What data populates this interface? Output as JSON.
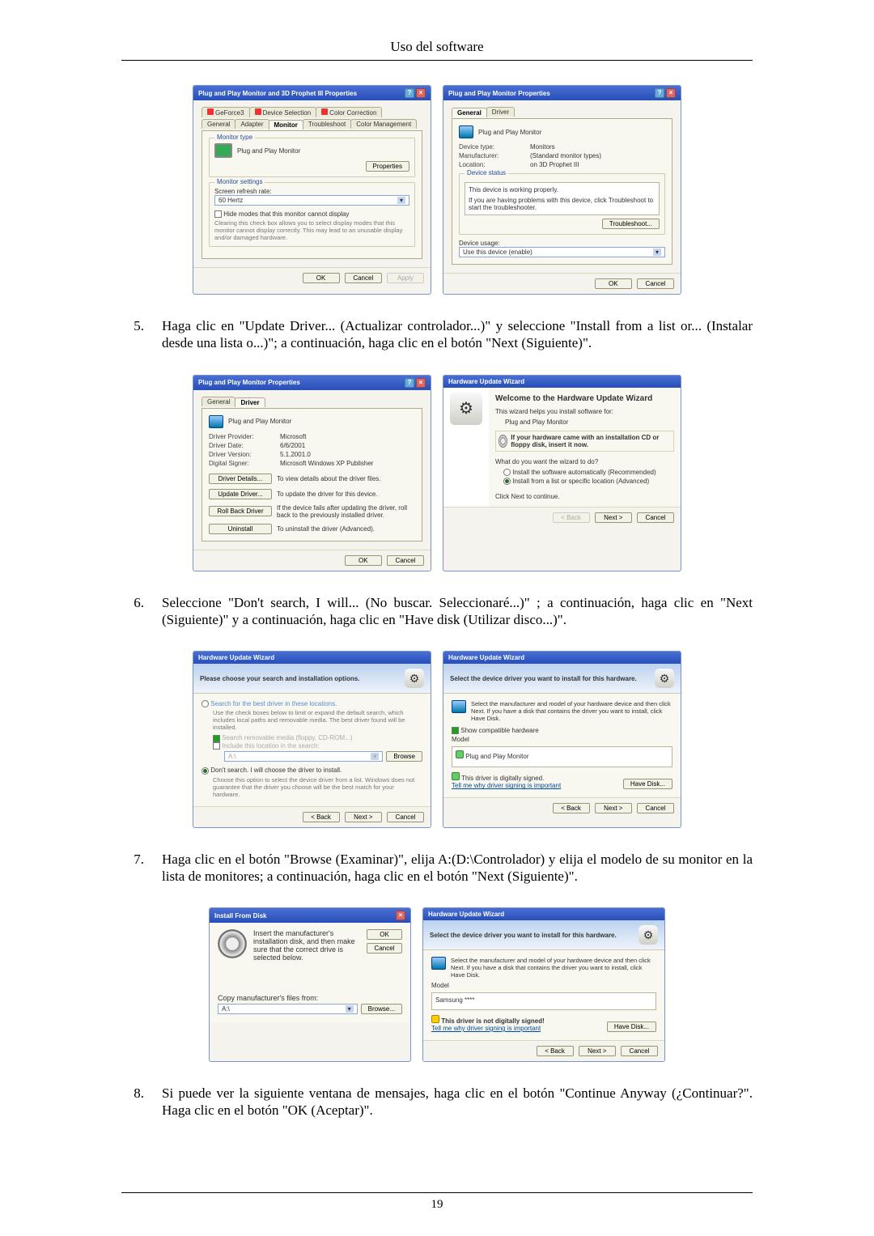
{
  "page": {
    "header": "Uso del software",
    "number": "19"
  },
  "steps": {
    "s5": {
      "num": "5.",
      "text": "Haga clic en \"Update Driver... (Actualizar controlador...)\" y seleccione \"Install from a list or... (Instalar desde una lista o...)\"; a continuación, haga clic en el botón \"Next (Siguiente)\"."
    },
    "s6": {
      "num": "6.",
      "text": "Seleccione \"Don't search, I will... (No buscar. Seleccionaré...)\" ; a continuación, haga clic en \"Next (Siguiente)\" y a continuación, haga clic en \"Have disk (Utilizar disco...)\"."
    },
    "s7": {
      "num": "7.",
      "text": "Haga clic en el botón \"Browse (Examinar)\", elija A:(D:\\Controlador) y elija el modelo de su monitor en la lista de monitores; a continuación, haga clic en el botón \"Next (Siguiente)\"."
    },
    "s8": {
      "num": "8.",
      "text": "Si puede ver la siguiente ventana de mensajes, haga clic en el botón \"Continue Anyway (¿Continuar?\". Haga clic en el botón \"OK (Aceptar)\"."
    }
  },
  "dlg1": {
    "title": "Plug and Play Monitor and 3D Prophet III Properties",
    "tabs_row1": [
      "GeForce3",
      "Device Selection",
      "Color Correction"
    ],
    "tabs_row2": [
      "General",
      "Adapter",
      "Monitor",
      "Troubleshoot",
      "Color Management"
    ],
    "monitor_type_label": "Monitor type",
    "monitor_name": "Plug and Play Monitor",
    "properties_btn": "Properties",
    "monitor_settings_label": "Monitor settings",
    "refresh_label": "Screen refresh rate:",
    "refresh_value": "60 Hertz",
    "hide_modes_label": "Hide modes that this monitor cannot display",
    "hide_modes_hint": "Clearing this check box allows you to select display modes that this monitor cannot display correctly. This may lead to an unusable display and/or damaged hardware.",
    "ok": "OK",
    "cancel": "Cancel",
    "apply": "Apply"
  },
  "dlg2": {
    "title": "Plug and Play Monitor Properties",
    "tabs": [
      "General",
      "Driver"
    ],
    "device": "Plug and Play Monitor",
    "type_label": "Device type:",
    "type_value": "Monitors",
    "manu_label": "Manufacturer:",
    "manu_value": "(Standard monitor types)",
    "loc_label": "Location:",
    "loc_value": "on 3D Prophet III",
    "status_label": "Device status",
    "status_text": "This device is working properly.",
    "status_hint": "If you are having problems with this device, click Troubleshoot to start the troubleshooter.",
    "troubleshoot": "Troubleshoot...",
    "usage_label": "Device usage:",
    "usage_value": "Use this device (enable)",
    "ok": "OK",
    "cancel": "Cancel"
  },
  "dlg3": {
    "title": "Plug and Play Monitor Properties",
    "tabs": [
      "General",
      "Driver"
    ],
    "device": "Plug and Play Monitor",
    "provider_label": "Driver Provider:",
    "provider_value": "Microsoft",
    "date_label": "Driver Date:",
    "date_value": "6/6/2001",
    "version_label": "Driver Version:",
    "version_value": "5.1.2001.0",
    "signer_label": "Digital Signer:",
    "signer_value": "Microsoft Windows XP Publisher",
    "details_btn": "Driver Details...",
    "details_hint": "To view details about the driver files.",
    "update_btn": "Update Driver...",
    "update_hint": "To update the driver for this device.",
    "rollback_btn": "Roll Back Driver",
    "rollback_hint": "If the device fails after updating the driver, roll back to the previously installed driver.",
    "uninstall_btn": "Uninstall",
    "uninstall_hint": "To uninstall the driver (Advanced).",
    "ok": "OK",
    "cancel": "Cancel"
  },
  "dlg4": {
    "title": "Hardware Update Wizard",
    "welcome": "Welcome to the Hardware Update Wizard",
    "intro": "This wizard helps you install software for:",
    "device": "Plug and Play Monitor",
    "cd_hint": "If your hardware came with an installation CD or floppy disk, insert it now.",
    "question": "What do you want the wizard to do?",
    "opt1": "Install the software automatically (Recommended)",
    "opt2": "Install from a list or specific location (Advanced)",
    "continue": "Click Next to continue.",
    "back": "< Back",
    "next": "Next >",
    "cancel": "Cancel"
  },
  "dlg5": {
    "title": "Hardware Update Wizard",
    "head": "Please choose your search and installation options.",
    "opt_search": "Search for the best driver in these locations.",
    "opt_search_hint": "Use the check boxes below to limit or expand the default search, which includes local paths and removable media. The best driver found will be installed.",
    "chk1": "Search removable media (floppy, CD-ROM...)",
    "chk2": "Include this location in the search:",
    "path": "A:\\",
    "browse": "Browse",
    "opt_dont": "Don't search. I will choose the driver to install.",
    "opt_dont_hint": "Choose this option to select the device driver from a list. Windows does not guarantee that the driver you choose will be the best match for your hardware.",
    "back": "< Back",
    "next": "Next >",
    "cancel": "Cancel"
  },
  "dlg6": {
    "title": "Hardware Update Wizard",
    "head": "Select the device driver you want to install for this hardware.",
    "hint": "Select the manufacturer and model of your hardware device and then click Next. If you have a disk that contains the driver you want to install, click Have Disk.",
    "show_compat": "Show compatible hardware",
    "model_label": "Model",
    "model_value": "Plug and Play Monitor",
    "signed": "This driver is digitally signed.",
    "tell_link": "Tell me why driver signing is important",
    "havedisk": "Have Disk...",
    "back": "< Back",
    "next": "Next >",
    "cancel": "Cancel"
  },
  "dlg7": {
    "title": "Install From Disk",
    "hint": "Insert the manufacturer's installation disk, and then make sure that the correct drive is selected below.",
    "ok": "OK",
    "cancel": "Cancel",
    "copy_label": "Copy manufacturer's files from:",
    "path": "A:\\",
    "browse": "Browse..."
  },
  "dlg8": {
    "title": "Hardware Update Wizard",
    "head": "Select the device driver you want to install for this hardware.",
    "hint": "Select the manufacturer and model of your hardware device and then click Next. If you have a disk that contains the driver you want to install, click Have Disk.",
    "model_label": "Model",
    "model_value": "Samsung ****",
    "unsigned": "This driver is not digitally signed!",
    "tell_link": "Tell me why driver signing is important",
    "havedisk": "Have Disk...",
    "back": "< Back",
    "next": "Next >",
    "cancel": "Cancel"
  }
}
